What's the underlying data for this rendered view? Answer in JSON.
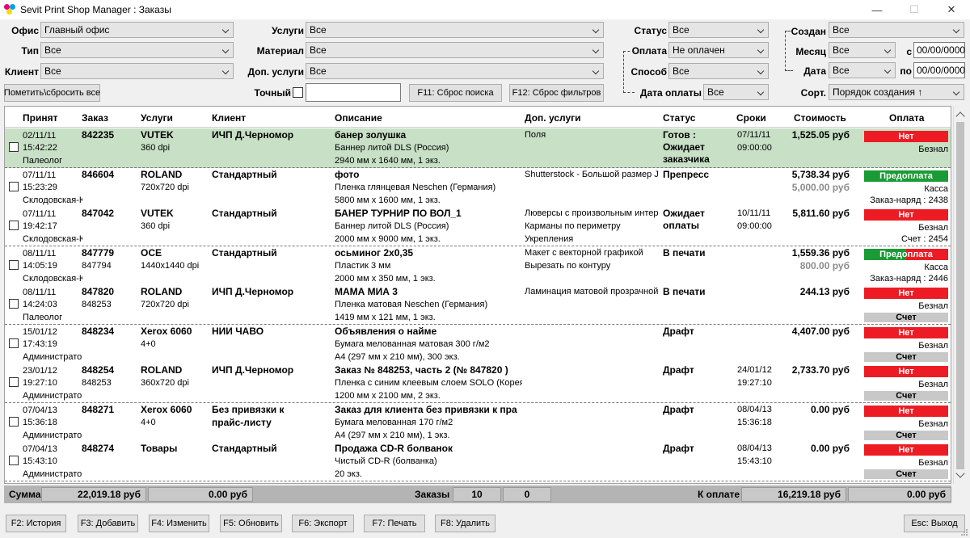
{
  "window": {
    "title": "Sevit Print Shop Manager : Заказы"
  },
  "filters": {
    "office_label": "Офис",
    "office_value": "Главный офис",
    "type_label": "Тип",
    "type_value": "Все",
    "client_label": "Клиент",
    "client_value": "Все",
    "mark_button": "Пометить\\сбросить все",
    "services_label": "Услуги",
    "services_value": "Все",
    "material_label": "Материал",
    "material_value": "Все",
    "extra_label": "Доп. услуги",
    "extra_value": "Все",
    "exact_label": "Точный",
    "search_value": "",
    "reset_search_button": "F11: Сброс поиска",
    "reset_filters_button": "F12: Сброс фильтров",
    "status_label": "Статус",
    "status_value": "Все",
    "payment_label": "Оплата",
    "payment_value": "Не оплачен",
    "method_label": "Способ",
    "method_value": "Все",
    "paydate_label": "Дата оплаты",
    "paydate_value": "Все",
    "created_label": "Создан",
    "created_value": "Все",
    "month_label": "Месяц",
    "month_value": "Все",
    "date_label": "Дата",
    "date_value": "Все",
    "from_label": "с",
    "from_value": "00/00/0000",
    "to_label": "по",
    "to_value": "00/00/0000",
    "sort_label": "Сорт.",
    "sort_value": "Порядок создания ↑"
  },
  "table": {
    "headers": [
      "Принят",
      "Заказ",
      "Услуги",
      "Клиент",
      "Описание",
      "Доп. услуги",
      "Статус",
      "Сроки",
      "Стоимость",
      "Оплата"
    ],
    "rows": [
      {
        "date": "02/11/11",
        "time": "15:42:22",
        "user": "Палеолог",
        "order": "842235",
        "order2": "",
        "service": "VUTEK",
        "service2": "360 dpi",
        "client": "ИЧП Д.Черномор",
        "client2": "",
        "desc_title": "банер золушка",
        "desc_line2": "Баннер литой DLS (Россия)",
        "desc_line3": "2940 мм x 1640 мм, 1  экз.",
        "extra1": "Поля",
        "extra2": "",
        "extra3": "",
        "status1": "Готов :",
        "status2": "Ожидает",
        "status3": "заказчика",
        "term1": "07/11/11",
        "term2": "09:00:00",
        "cost": "1,525.05 руб",
        "cost2": "",
        "pay": "Нет",
        "pay_method": "Безнал",
        "pay_doc": ""
      },
      {
        "date": "07/11/11",
        "time": "15:23:29",
        "user": "Склодовская-К",
        "order": "846604",
        "order2": "",
        "service": "ROLAND",
        "service2": "720x720 dpi",
        "client": "Стандартный",
        "client2": "",
        "desc_title": "фото",
        "desc_line2": "Пленка глянцевая Neschen (Германия)",
        "desc_line3": "5800 мм x 1600 мм, 1  экз.",
        "extra1": "Shutterstock - Большой размер JI",
        "extra2": "",
        "extra3": "",
        "status1": "Препресс",
        "status2": "",
        "status3": "",
        "term1": "",
        "term2": "",
        "cost": "5,738.34 руб",
        "cost2": "5,000.00 руб",
        "pay": "Предоплата",
        "pay_method": "Касса",
        "pay_doc": "Заказ-наряд : 2438"
      },
      {
        "date": "07/11/11",
        "time": "19:42:17",
        "user": "Склодовская-К",
        "order": "847042",
        "order2": "",
        "service": "VUTEK",
        "service2": "360 dpi",
        "client": "Стандартный",
        "client2": "",
        "desc_title": "БАНЕР ТУРНИР ПО ВОЛ_1",
        "desc_line2": "Баннер литой DLS (Россия)",
        "desc_line3": "2000 мм x 9000 мм, 1  экз.",
        "extra1": "Люверсы с произвольным интерв",
        "extra2": "Карманы по периметру",
        "extra3": "Укрепления",
        "status1": "Ожидает",
        "status2": "оплаты",
        "status3": "",
        "term1": "10/11/11",
        "term2": "09:00:00",
        "cost": "5,811.60 руб",
        "cost2": "",
        "pay": "Нет",
        "pay_method": "Безнал",
        "pay_doc": "Счет : 2454"
      },
      {
        "date": "08/11/11",
        "time": "14:05:19",
        "user": "Склодовская-К",
        "order": "847779",
        "order2": "847794",
        "service": "OCE",
        "service2": "1440x1440 dpi",
        "client": "Стандартный",
        "client2": "",
        "desc_title": "осьминог 2x0,35",
        "desc_line2": "Пластик 3 мм",
        "desc_line3": "2000 мм x 350 мм, 1  экз.",
        "extra1": "Макет с векторной графикой",
        "extra2": "Вырезать по контуру",
        "extra3": "",
        "status1": "В печати",
        "status2": "",
        "status3": "",
        "term1": "",
        "term2": "",
        "cost": "1,559.36 руб",
        "cost2": "800.00 руб",
        "pay": "Предоплата",
        "pay_method": "Касса",
        "pay_doc": "Заказ-наряд : 2446"
      },
      {
        "date": "08/11/11",
        "time": "14:24:03",
        "user": "Палеолог",
        "order": "847820",
        "order2": "848253",
        "service": "ROLAND",
        "service2": "720x720 dpi",
        "client": "ИЧП Д.Черномор",
        "client2": "",
        "desc_title": "МАМА МИА 3",
        "desc_line2": "Пленка матовая Neschen (Германия)",
        "desc_line3": "1419 мм x 121 мм, 1  экз.",
        "extra1": "Ламинация матовой прозрачной",
        "extra2": "",
        "extra3": "",
        "status1": "В печати",
        "status2": "",
        "status3": "",
        "term1": "",
        "term2": "",
        "cost": "244.13 руб",
        "cost2": "",
        "pay": "Нет",
        "pay_method": "Безнал",
        "pay_doc": "Счет"
      },
      {
        "date": "15/01/12",
        "time": "17:43:19",
        "user": "Администрато",
        "order": "848234",
        "order2": "",
        "service": "Xerox 6060",
        "service2": "4+0",
        "client": "НИИ ЧАВО",
        "client2": "",
        "desc_title": "Объявления о найме",
        "desc_line2": "Бумага мелованная матовая 300 г/м2",
        "desc_line3": "A4 (297 мм x 210 мм), 300  экз.",
        "extra1": "",
        "extra2": "",
        "extra3": "",
        "status1": "Драфт",
        "status2": "",
        "status3": "",
        "term1": "",
        "term2": "",
        "cost": "4,407.00 руб",
        "cost2": "",
        "pay": "Нет",
        "pay_method": "Безнал",
        "pay_doc": "Счет"
      },
      {
        "date": "23/01/12",
        "time": "19:27:10",
        "user": "Администрато",
        "order": "848254",
        "order2": "848253",
        "service": "ROLAND",
        "service2": "360x720 dpi",
        "client": "ИЧП Д.Черномор",
        "client2": "",
        "desc_title": "Заказ № 848253, часть 2 (№ 847820 )",
        "desc_line2": "Пленка с синим клеевым слоем SOLO (Корея",
        "desc_line3": "1200 мм x 2100 мм, 2  экз.",
        "extra1": "",
        "extra2": "",
        "extra3": "",
        "status1": "Драфт",
        "status2": "",
        "status3": "",
        "term1": "24/01/12",
        "term2": "19:27:10",
        "cost": "2,733.70 руб",
        "cost2": "",
        "pay": "Нет",
        "pay_method": "Безнал",
        "pay_doc": "Счет"
      },
      {
        "date": "07/04/13",
        "time": "15:36:18",
        "user": "Администрато",
        "order": "848271",
        "order2": "",
        "service": "Xerox 6060",
        "service2": "4+0",
        "client": "Без привязки к",
        "client2": "прайс-листу",
        "desc_title": "Заказ для клиента без привязки к пра",
        "desc_line2": "Бумага мелованная 170 г/м2",
        "desc_line3": "A4 (297 мм x 210 мм), 1  экз.",
        "extra1": "",
        "extra2": "",
        "extra3": "",
        "status1": "Драфт",
        "status2": "",
        "status3": "",
        "term1": "08/04/13",
        "term2": "15:36:18",
        "cost": "0.00 руб",
        "cost2": "",
        "pay": "Нет",
        "pay_method": "Безнал",
        "pay_doc": "Счет"
      },
      {
        "date": "07/04/13",
        "time": "15:43:10",
        "user": "Администрато",
        "order": "848274",
        "order2": "",
        "service": "Товары",
        "service2": "",
        "client": "Стандартный",
        "client2": "",
        "desc_title": "Продажа CD-R болванок",
        "desc_line2": "Чистый CD-R (болванка)",
        "desc_line3": "20  экз.",
        "extra1": "",
        "extra2": "",
        "extra3": "",
        "status1": "Драфт",
        "status2": "",
        "status3": "",
        "term1": "08/04/13",
        "term2": "15:43:10",
        "cost": "0.00 руб",
        "cost2": "",
        "pay": "Нет",
        "pay_method": "Безнал",
        "pay_doc": "Счет"
      }
    ]
  },
  "summary": {
    "sum_label": "Сумма",
    "sum_value": "22,019.18 руб",
    "sum_value2": "0.00 руб",
    "orders_label": "Заказы",
    "orders_count": "10",
    "orders_count2": "0",
    "topay_label": "К оплате",
    "topay_value": "16,219.18 руб",
    "topay_value2": "0.00 руб"
  },
  "bottom": {
    "history": "F2: История",
    "add": "F3: Добавить",
    "edit": "F4: Изменить",
    "refresh": "F5: Обновить",
    "export": "F6: Экспорт",
    "print": "F7: Печать",
    "delete": "F8: Удалить",
    "exit": "Esc: Выход"
  },
  "colors": {
    "selected_row": "#c7e0c6",
    "unpaid": "#ed1c24",
    "prepaid": "#1a9b35",
    "summary_bg": "#b4b4b4"
  }
}
